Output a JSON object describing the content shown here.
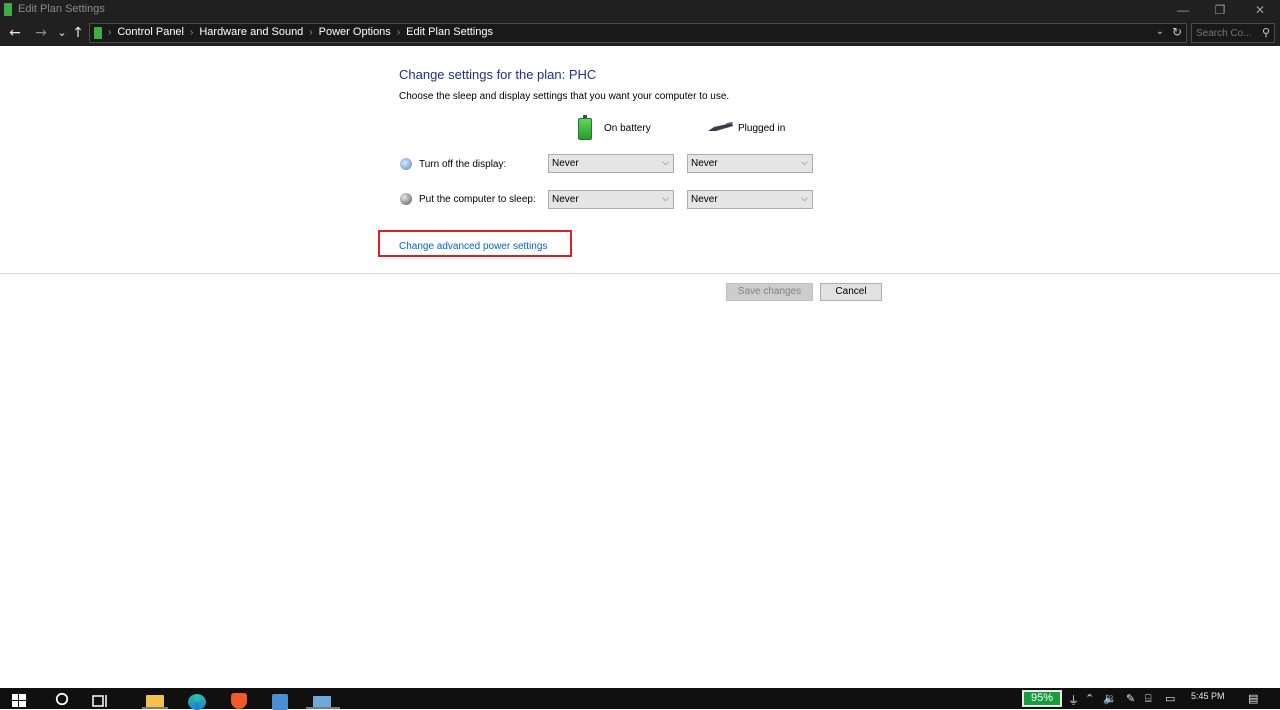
{
  "window": {
    "title": "Edit Plan Settings",
    "controls": {
      "minimize": "—",
      "restore": "❐",
      "close": "✕"
    }
  },
  "navigation": {
    "back": "←",
    "forward": "→",
    "recent": "⌄",
    "up": "↑",
    "breadcrumb": [
      "Control Panel",
      "Hardware and Sound",
      "Power Options",
      "Edit Plan Settings"
    ],
    "breadcrumb_separator": "›",
    "address_dropdown": "⌄",
    "refresh": "↻",
    "search_placeholder": "Search Co...",
    "search_icon": "⚲"
  },
  "main": {
    "heading": "Change settings for the plan: PHC",
    "description": "Choose the sleep and display settings that you want your computer to use.",
    "columns": {
      "battery": {
        "label": "On battery",
        "icon": "battery-icon"
      },
      "plugged": {
        "label": "Plugged in",
        "icon": "plug-icon"
      }
    },
    "settings": [
      {
        "label": "Turn off the display:",
        "icon": "display-icon",
        "battery_value": "Never",
        "plugged_value": "Never"
      },
      {
        "label": "Put the computer to sleep:",
        "icon": "sleep-icon",
        "battery_value": "Never",
        "plugged_value": "Never"
      }
    ],
    "advanced_link": "Change advanced power settings",
    "save_button": "Save changes",
    "cancel_button": "Cancel",
    "accent_color": "#1e3287",
    "link_color": "#0066cc",
    "highlight_color": "#e21d1d"
  },
  "taskbar": {
    "battery_percent": "95%",
    "time": "5:45 PM",
    "battery_color": "#1a9c3e"
  }
}
